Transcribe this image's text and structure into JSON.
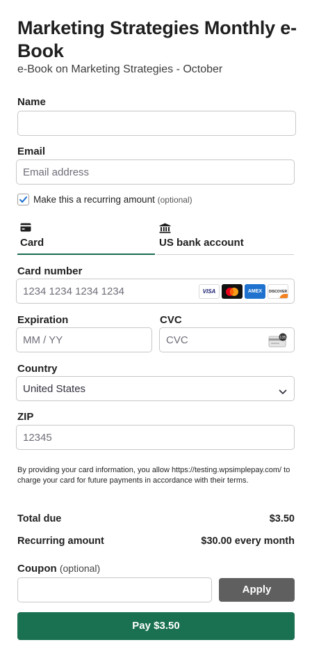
{
  "header": {
    "title": "Marketing Strategies Monthly e-Book",
    "subtitle": "e-Book on Marketing Strategies - October"
  },
  "form": {
    "name_label": "Name",
    "name_value": "",
    "email_label": "Email",
    "email_placeholder": "Email address",
    "recurring_label": "Make this a recurring amount",
    "recurring_optional": "(optional)",
    "recurring_checked": true
  },
  "payment_tabs": [
    {
      "label": "Card",
      "icon": "credit-card-icon",
      "active": true
    },
    {
      "label": "US bank account",
      "icon": "bank-icon",
      "active": false
    }
  ],
  "card": {
    "number_label": "Card number",
    "number_placeholder": "1234 1234 1234 1234",
    "brands": [
      "VISA",
      "Mastercard",
      "AMEX",
      "DISCOVER"
    ],
    "expiration_label": "Expiration",
    "expiration_placeholder": "MM / YY",
    "cvc_label": "CVC",
    "cvc_placeholder": "CVC",
    "country_label": "Country",
    "country_value": "United States",
    "zip_label": "ZIP",
    "zip_placeholder": "12345"
  },
  "disclaimer": "By providing your card information, you allow https://testing.wpsimplepay.com/ to charge your card for future payments in accordance with their terms.",
  "summary": {
    "total_label": "Total due",
    "total_value": "$3.50",
    "recurring_label": "Recurring amount",
    "recurring_value": "$30.00 every month"
  },
  "coupon": {
    "label": "Coupon",
    "optional": "(optional)",
    "value": "",
    "apply_label": "Apply"
  },
  "pay_button_label": "Pay $3.50",
  "colors": {
    "accent": "#1a7152",
    "apply_button": "#5f5f5f",
    "checkbox": "#1a6fd0"
  }
}
